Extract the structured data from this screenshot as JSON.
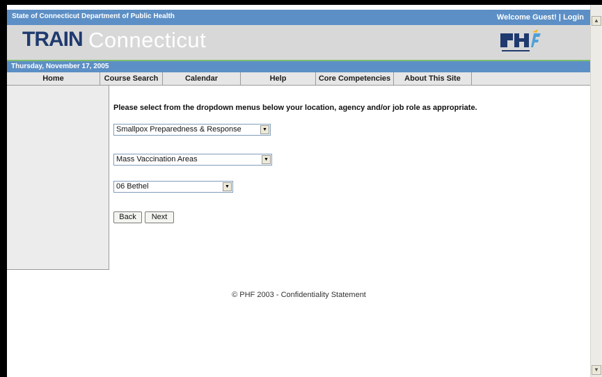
{
  "header": {
    "org_label": "State of Connecticut Department of Public Health",
    "welcome": "Welcome Guest! | Login",
    "logo_train": "TRAIN",
    "logo_region": "Connecticut",
    "date": "Thursday, November 17, 2005"
  },
  "nav": {
    "items": [
      {
        "label": "Home"
      },
      {
        "label": "Course Search"
      },
      {
        "label": "Calendar"
      },
      {
        "label": "Help"
      },
      {
        "label": "Core Competencies"
      },
      {
        "label": "About This Site"
      }
    ]
  },
  "main": {
    "prompt": "Please select from the dropdown menus below your location, agency and/or job role as appropriate.",
    "select1_value": "Smallpox Preparedness & Response",
    "select2_value": "Mass Vaccination Areas",
    "select3_value": "06 Bethel",
    "back_label": "Back",
    "next_label": "Next"
  },
  "footer": {
    "text": "© PHF 2003 - Confidentiality Statement"
  },
  "colors": {
    "top_bar": "#5c8fc5",
    "header_bg": "#d8d8d8",
    "logo_dark": "#1f3a6e",
    "accent_line": "#7dbd6a"
  }
}
